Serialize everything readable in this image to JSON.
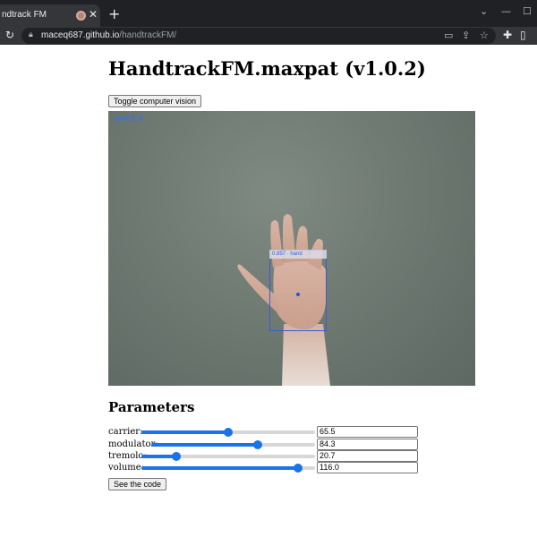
{
  "browser": {
    "tab_title": "ndtrack FM",
    "close_glyph": "✕",
    "new_tab_glyph": "+",
    "url_host": "maceq687.github.io",
    "url_path": "/handtrackFM/",
    "icons": [
      "back-icon",
      "forward-icon",
      "reload-icon",
      "lock-icon",
      "cast-icon",
      "share-icon",
      "bookmark-icon",
      "extensions-icon",
      "sidepanel-icon",
      "menu-icon"
    ]
  },
  "page": {
    "title": "HandtrackFM.maxpat (v1.0.2)",
    "toggle_button": "Toggle computer vision",
    "video": {
      "fps_text": "@FPS: 8",
      "detection_label": "0.857 · hand"
    },
    "parameters_heading": "Parameters",
    "parameters": [
      {
        "label": "carrier:",
        "value": "65.5",
        "fraction": 0.5
      },
      {
        "label": "modulator:",
        "value": "84.3",
        "fraction": 0.65
      },
      {
        "label": "tremolo:",
        "value": "20.7",
        "fraction": 0.2
      },
      {
        "label": "volume:",
        "value": "116.0",
        "fraction": 0.9
      }
    ],
    "code_button": "See the code"
  },
  "colors": {
    "accent": "#1a73e8",
    "chrome_dark": "#202124",
    "chrome_mid": "#35363a"
  }
}
